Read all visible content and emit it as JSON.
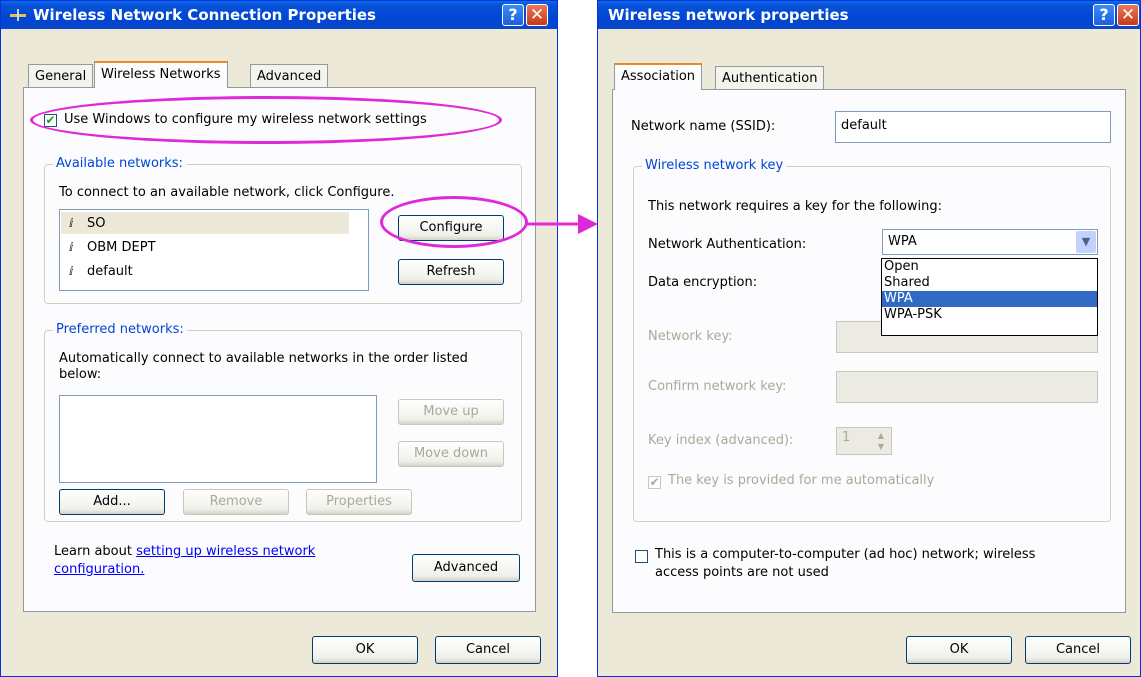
{
  "left": {
    "title": "Wireless Network Connection Properties",
    "tabs": [
      "General",
      "Wireless Networks",
      "Advanced"
    ],
    "use_windows_label": "Use Windows to configure my wireless network settings",
    "available": {
      "legend": "Available networks:",
      "instruction": "To connect to an available network, click Configure.",
      "networks": [
        "SO",
        "OBM DEPT",
        "default"
      ],
      "configure": "Configure",
      "refresh": "Refresh"
    },
    "preferred": {
      "legend": "Preferred networks:",
      "instruction_line1": "Automatically connect to available networks in the order listed",
      "instruction_line2": "below:",
      "move_up": "Move up",
      "move_down": "Move down",
      "add": "Add...",
      "remove": "Remove",
      "properties": "Properties"
    },
    "learn_prefix": "Learn about",
    "learn_link_1": "setting up wireless network",
    "learn_link_2": "configuration.",
    "advanced": "Advanced",
    "ok": "OK",
    "cancel": "Cancel"
  },
  "right": {
    "title": "Wireless network properties",
    "tabs": [
      "Association",
      "Authentication"
    ],
    "ssid_label": "Network name (SSID):",
    "ssid_value": "default",
    "key_group": {
      "legend": "Wireless network key",
      "requires": "This network requires a key for the following:",
      "auth_label": "Network Authentication:",
      "auth_value": "WPA",
      "auth_options": [
        "Open",
        "Shared",
        "WPA",
        "WPA-PSK"
      ],
      "encryption_label": "Data encryption:",
      "network_key_label": "Network key:",
      "confirm_key_label": "Confirm network key:",
      "key_index_label": "Key index (advanced):",
      "key_index_value": "1",
      "auto_key_label": "The key is provided for me automatically"
    },
    "adhoc_line1": "This is a computer-to-computer (ad hoc) network; wireless",
    "adhoc_line2": "access points are not used",
    "ok": "OK",
    "cancel": "Cancel"
  },
  "colors": {
    "highlight": "#e028d8",
    "title_bar": "#0046d5",
    "selection": "#316ac5"
  }
}
